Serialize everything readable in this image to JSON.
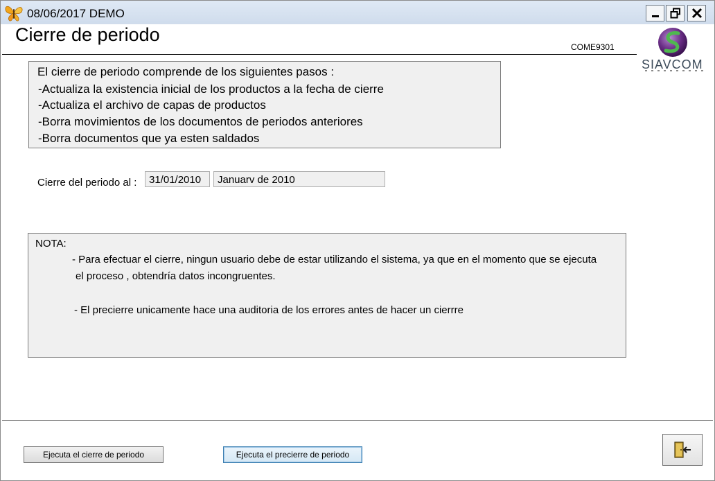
{
  "titlebar": {
    "title": "08/06/2017  DEMO",
    "icons": {
      "app": "butterfly-icon",
      "minimize": "minimize-icon",
      "restore": "restore-icon",
      "close": "close-icon"
    }
  },
  "header": {
    "page_title": "Cierre de periodo",
    "screen_code": "COME9301",
    "logo_text": "SIAVCOM"
  },
  "steps": {
    "lines": [
      "El cierre de periodo comprende de los siguientes pasos :",
      "-Actualiza la existencia inicial de los productos a la fecha de cierre",
      "-Actualiza el archivo de capas de productos",
      "-Borra movimientos de los documentos de periodos anteriores",
      "-Borra documentos que ya esten saldados"
    ]
  },
  "period": {
    "label": "Cierre del periodo al :",
    "date_value": "31/01/2010",
    "month_value": "Januarv de 2010"
  },
  "note": {
    "heading": "NOTA:",
    "lines": [
      "- Para efectuar el cierre, ningun usuario debe de estar utilizando el sistema, ya que en el  momento que se ejecuta",
      "el proceso , obtendría datos incongruentes.",
      "- El precierre unicamente hace una auditoria de los errores antes de hacer un cierrre"
    ]
  },
  "buttons": {
    "close_period": "Ejecuta el cierre de periodo",
    "pre_close_period": "Ejecuta el precierre de periodo",
    "exit_icon": "exit-door-icon"
  },
  "colors": {
    "titlebar": "#d6e2f0",
    "panel": "#f0f0f0",
    "logo_purple": "#6a2d86",
    "logo_green": "#4fb84f"
  }
}
